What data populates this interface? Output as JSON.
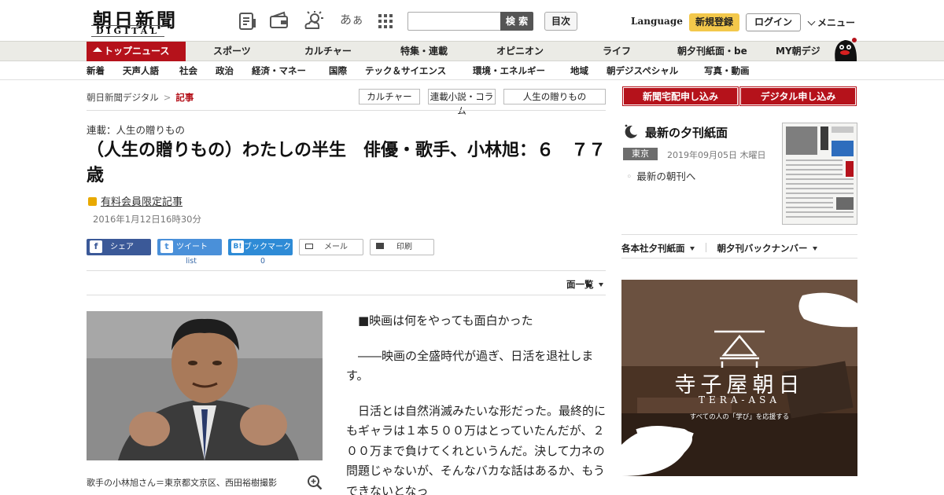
{
  "header": {
    "logo_jp": "朝日新聞",
    "logo_en": "DIGITAL",
    "icons": [
      "newspaper-icon",
      "wallet-icon",
      "weather-icon",
      "font-size-icon",
      "apps-grid-icon"
    ],
    "font_size_glyph": "あぁ",
    "search": {
      "placeholder": "",
      "button_label": "検 索"
    },
    "toc_label": "目次",
    "language_label": "Language",
    "register_label": "新規登録",
    "login_label": "ログイン",
    "menu_label": "メニュー"
  },
  "nav_main": {
    "items": [
      "トップニュース",
      "スポーツ",
      "カルチャー",
      "特集・連載",
      "オピニオン",
      "ライフ",
      "朝夕刊紙面・be",
      "MY朝デジ"
    ]
  },
  "nav_sub": {
    "items": [
      "新着",
      "天声人語",
      "社会",
      "政治",
      "経済・マネー",
      "国際",
      "テック＆サイエンス",
      "環境・エネルギー",
      "地域",
      "朝デジスペシャル",
      "写真・動画"
    ]
  },
  "breadcrumb": {
    "home": "朝日新聞デジタル",
    "separator": ">",
    "current": "記事"
  },
  "tags": [
    "カルチャー",
    "連載小説・コラム",
    "人生の贈りもの"
  ],
  "article": {
    "series": "連載：人生の贈りもの",
    "headline": "（人生の贈りもの）わたしの半生　俳優・歌手、小林旭：６　７７歳",
    "paid_label": "有料会員限定記事",
    "date": "2016年1月12日16時30分",
    "share": {
      "facebook": "シェア",
      "twitter": "ツイート",
      "twitter_count": "list",
      "hatena": "ブックマーク",
      "hatena_count": "0",
      "mail": "メール",
      "print": "印刷"
    },
    "pages_menu": "面一覧",
    "caption": "歌手の小林旭さん＝東京都文京区、西田裕樹撮影",
    "paragraphs": [
      "■映画は何をやっても面白かった",
      "――映画の全盛時代が過ぎ、日活を退社します。",
      "日活とは自然消滅みたいな形だった。最終的にもギャラは１本５００万はとっていたんだが、２００万まで負けてくれというんだ。決して力ネの問題じゃないが、そんなバカな話はあるか、もうできないとなっ"
    ]
  },
  "sidebar": {
    "subscribe_paper": "新聞宅配申し込み",
    "subscribe_digital": "デジタル申し込み",
    "evening_title": "最新の夕刊紙面",
    "region": "東京",
    "issue_date": "2019年09月05日 木曜日",
    "morning_link": "最新の朝刊へ",
    "edition_links": [
      "各本社夕刊紙面",
      "朝夕刊バックナンバー"
    ],
    "ad": {
      "title": "寺子屋朝日",
      "subtitle": "TERA-ASA",
      "tagline": "すべての人の「学び」を応援する"
    }
  },
  "colors": {
    "brand_red": "#b5121b",
    "register_yellow": "#f3c84b",
    "link_blue": "#3a6aa8"
  }
}
